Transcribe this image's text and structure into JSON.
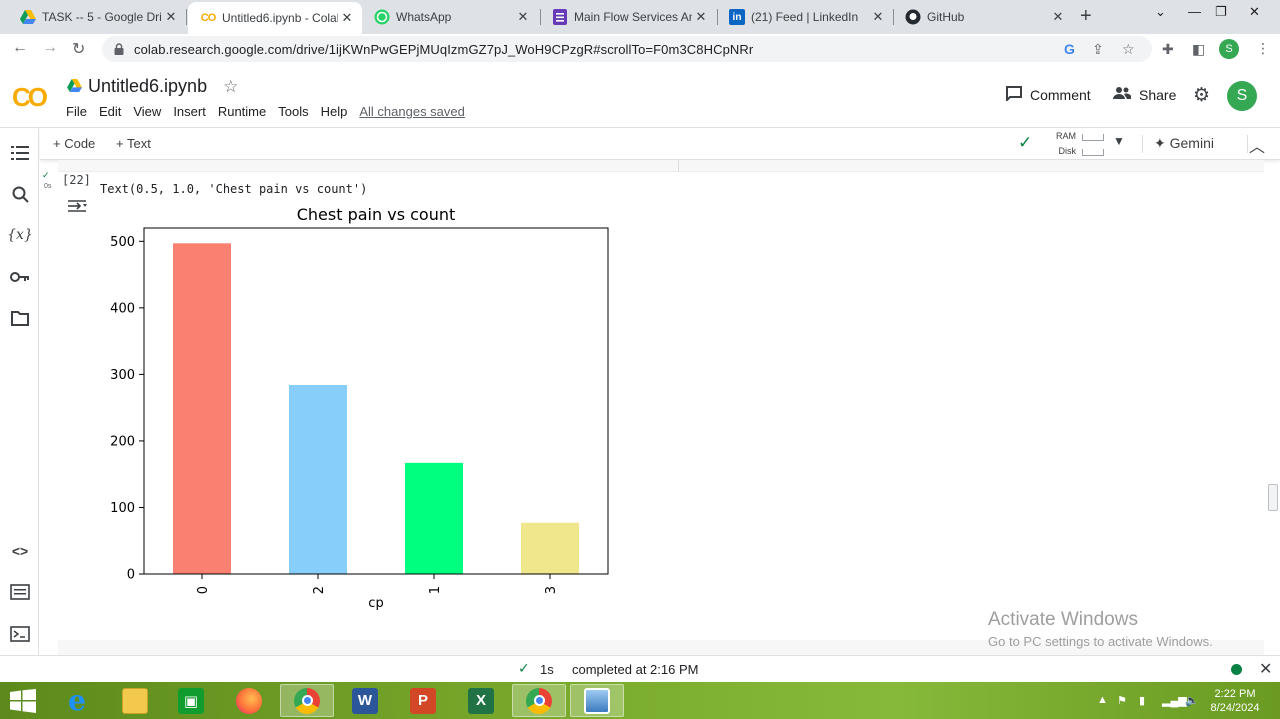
{
  "browser": {
    "tabs": [
      {
        "title": "TASK -- 5 - Google Driv",
        "icon": "google-drive-icon",
        "active": false
      },
      {
        "title": "Untitled6.ipynb - Colab",
        "icon": "colab-icon",
        "active": true
      },
      {
        "title": "WhatsApp",
        "icon": "whatsapp-icon",
        "active": false
      },
      {
        "title": "Main Flow Services And",
        "icon": "forms-icon",
        "active": false
      },
      {
        "title": "(21) Feed | LinkedIn",
        "icon": "linkedin-icon",
        "active": false
      },
      {
        "title": "GitHub",
        "icon": "github-icon",
        "active": false
      }
    ],
    "new_tab": "+",
    "url": "colab.research.google.com/drive/1ijKWnPwGEPjMUqIzmGZ7pJ_WoH9CPzgR#scrollTo=F0m3C8HCpNRr",
    "profile_initial": "S"
  },
  "colab": {
    "logo_text": "CO",
    "notebook_title": "Untitled6.ipynb",
    "menu": [
      "File",
      "Edit",
      "View",
      "Insert",
      "Runtime",
      "Tools",
      "Help"
    ],
    "save_status": "All changes saved",
    "comment_label": "Comment",
    "share_label": "Share",
    "avatar_initial": "S",
    "add_code_label": "+ Code",
    "add_text_label": "+ Text",
    "ram_label": "RAM",
    "disk_label": "Disk",
    "gemini_label": "Gemini"
  },
  "cell": {
    "exec_count": "[22]",
    "run_time": "0s",
    "output_text": "Text(0.5, 1.0, 'Chest pain vs count')"
  },
  "chart_data": {
    "type": "bar",
    "title": "Chest pain vs count",
    "xlabel": "cp",
    "ylabel": "",
    "categories": [
      "0",
      "2",
      "1",
      "3"
    ],
    "values": [
      497,
      284,
      167,
      77
    ],
    "colors": [
      "#fa8072",
      "#87cefa",
      "#00ff7f",
      "#f0e68c"
    ],
    "ylim": [
      0,
      520
    ],
    "yticks": [
      0,
      100,
      200,
      300,
      400,
      500
    ],
    "grid": false
  },
  "watermark": {
    "line1": "Activate Windows",
    "line2": "Go to PC settings to activate Windows."
  },
  "status": {
    "duration": "1s",
    "completed": "completed at 2:16 PM"
  },
  "taskbar": {
    "apps": [
      "internet-explorer",
      "file-explorer",
      "store",
      "firefox",
      "chrome",
      "word",
      "powerpoint",
      "excel",
      "chrome",
      "photos"
    ],
    "time": "2:22 PM",
    "date": "8/24/2024"
  }
}
